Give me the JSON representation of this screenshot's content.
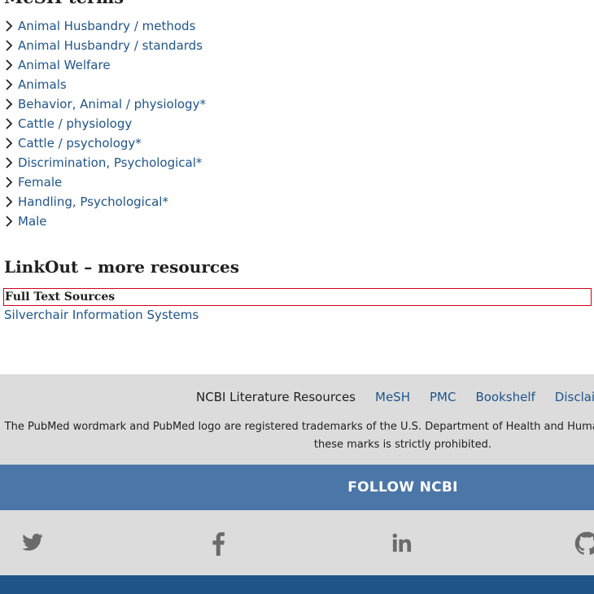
{
  "mesh": {
    "heading": "MeSH terms",
    "items": [
      "Animal Husbandry / methods",
      "Animal Husbandry / standards",
      "Animal Welfare",
      "Animals",
      "Behavior, Animal / physiology*",
      "Cattle / physiology",
      "Cattle / psychology*",
      "Discrimination, Psychological*",
      "Female",
      "Handling, Psychological*",
      "Male"
    ]
  },
  "linkout": {
    "heading": "LinkOut – more resources",
    "full_text_label": "Full Text Sources",
    "provider": "Silverchair Information Systems"
  },
  "footer": {
    "literature_label": "NCBI Literature Resources",
    "links": [
      "MeSH",
      "PMC",
      "Bookshelf",
      "Disclaimer"
    ],
    "trademark_line1": "The PubMed wordmark and PubMed logo are registered trademarks of the U.S. Department of Health and Human Services (HHS). Unauthorized use of",
    "trademark_line2": "these marks is strictly prohibited."
  },
  "follow": {
    "label": "FOLLOW NCBI"
  },
  "social": {
    "icons": [
      "twitter-icon",
      "facebook-icon",
      "linkedin-icon",
      "github-icon"
    ]
  },
  "colors": {
    "link": "#20558a",
    "follow_bar": "#4a76a8",
    "footer_bg": "#dcdcdc",
    "highlight_border": "#d0021b"
  }
}
